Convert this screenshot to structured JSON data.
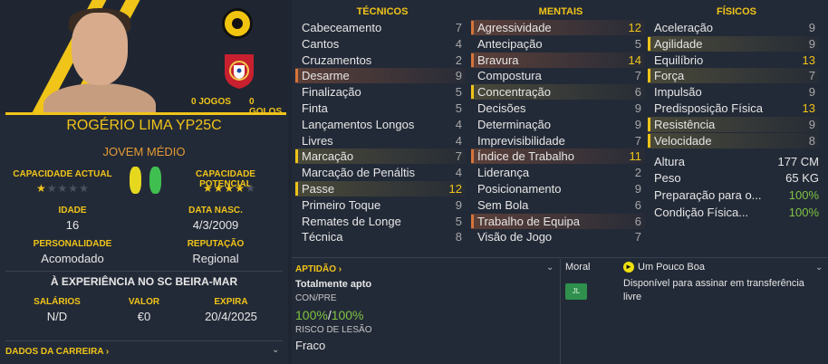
{
  "player": {
    "jogos": "0 JOGOS",
    "golos": "0 GOLOS",
    "name": "ROGÉRIO LIMA YP25C",
    "role": "JOVEM MÉDIO",
    "ca_label": "CAPACIDADE ACTUAL",
    "cp_label": "CAPACIDADE POTENCIAL",
    "ca_stars": 1,
    "cp_stars": 4,
    "idade_label": "IDADE",
    "idade": "16",
    "nasc_label": "DATA NASC.",
    "nasc": "4/3/2009",
    "pers_label": "PERSONALIDADE",
    "pers": "Acomodado",
    "rep_label": "REPUTAÇÃO",
    "rep": "Regional",
    "experience": "À EXPERIÊNCIA NO SC BEIRA-MAR",
    "sal_label": "SALÁRIOS",
    "sal": "N/D",
    "valor_label": "VALOR",
    "valor": "€0",
    "expira_label": "EXPIRA",
    "expira": "20/4/2025",
    "career": "DADOS DA CARREIRA  ›"
  },
  "headers": {
    "tecnicos": "TÉCNICOS",
    "mentais": "MENTAIS",
    "fisicos": "FÍSICOS"
  },
  "tecnicos": [
    {
      "name": "Cabeceamento",
      "value": "7",
      "hl": ""
    },
    {
      "name": "Cantos",
      "value": "4",
      "hl": ""
    },
    {
      "name": "Cruzamentos",
      "value": "2",
      "hl": ""
    },
    {
      "name": "Desarme",
      "value": "9",
      "hl": "hr"
    },
    {
      "name": "Finalização",
      "value": "5",
      "hl": ""
    },
    {
      "name": "Finta",
      "value": "5",
      "hl": ""
    },
    {
      "name": "Lançamentos Longos",
      "value": "4",
      "hl": ""
    },
    {
      "name": "Livres",
      "value": "4",
      "hl": ""
    },
    {
      "name": "Marcação",
      "value": "7",
      "hl": "hl"
    },
    {
      "name": "Marcação de Penáltis",
      "value": "4",
      "hl": ""
    },
    {
      "name": "Passe",
      "value": "12",
      "hl": "hl"
    },
    {
      "name": "Primeiro Toque",
      "value": "9",
      "hl": ""
    },
    {
      "name": "Remates de Longe",
      "value": "5",
      "hl": ""
    },
    {
      "name": "Técnica",
      "value": "8",
      "hl": ""
    }
  ],
  "mentais": [
    {
      "name": "Agressividade",
      "value": "12",
      "hl": "hr"
    },
    {
      "name": "Antecipação",
      "value": "5",
      "hl": ""
    },
    {
      "name": "Bravura",
      "value": "14",
      "hl": "hr"
    },
    {
      "name": "Compostura",
      "value": "7",
      "hl": ""
    },
    {
      "name": "Concentração",
      "value": "6",
      "hl": "hl"
    },
    {
      "name": "Decisões",
      "value": "9",
      "hl": ""
    },
    {
      "name": "Determinação",
      "value": "9",
      "hl": ""
    },
    {
      "name": "Imprevisibilidade",
      "value": "7",
      "hl": ""
    },
    {
      "name": "Índice de Trabalho",
      "value": "11",
      "hl": "hr"
    },
    {
      "name": "Liderança",
      "value": "2",
      "hl": ""
    },
    {
      "name": "Posicionamento",
      "value": "9",
      "hl": ""
    },
    {
      "name": "Sem Bola",
      "value": "6",
      "hl": ""
    },
    {
      "name": "Trabalho de Equipa",
      "value": "6",
      "hl": "hr"
    },
    {
      "name": "Visão de Jogo",
      "value": "7",
      "hl": ""
    }
  ],
  "fisicos": [
    {
      "name": "Aceleração",
      "value": "9",
      "hl": ""
    },
    {
      "name": "Agilidade",
      "value": "9",
      "hl": "hl"
    },
    {
      "name": "Equilíbrio",
      "value": "13",
      "hl": ""
    },
    {
      "name": "Força",
      "value": "7",
      "hl": "hl"
    },
    {
      "name": "Impulsão",
      "value": "9",
      "hl": ""
    },
    {
      "name": "Predisposição Física",
      "value": "13",
      "hl": ""
    },
    {
      "name": "Resistência",
      "value": "9",
      "hl": "hl"
    },
    {
      "name": "Velocidade",
      "value": "8",
      "hl": "hl"
    }
  ],
  "body": {
    "altura_label": "Altura",
    "altura": "177 CM",
    "peso_label": "Peso",
    "peso": "65 KG",
    "prep_label": "Preparação para o...",
    "prep": "100%",
    "cond_label": "Condição Física...",
    "cond": "100%"
  },
  "aptidao": {
    "label": "APTIDÃO  ›",
    "status": "Totalmente apto",
    "conpre_label": "CON/PRE",
    "con": "100%",
    "slash": "/",
    "pre": "100%",
    "risco_label": "RISCO DE LESÃO",
    "risco": "Fraco"
  },
  "moral": {
    "label": "Moral",
    "value": "Um Pouco Boa",
    "jl_badge": "JL",
    "transfer": "Disponível para assinar em transferência livre"
  }
}
